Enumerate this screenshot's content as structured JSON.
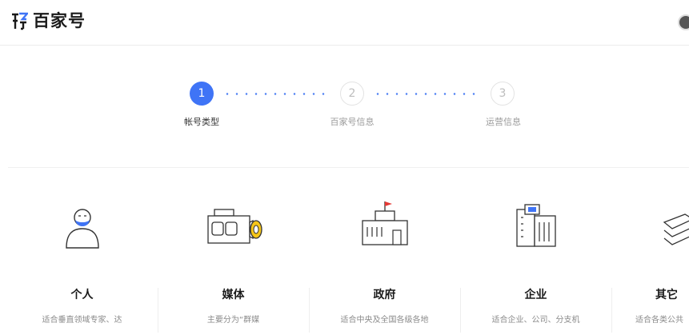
{
  "header": {
    "logo_text": "百家号"
  },
  "steps": [
    {
      "number": "1",
      "label": "帐号类型",
      "active": true
    },
    {
      "number": "2",
      "label": "百家号信息",
      "active": false
    },
    {
      "number": "3",
      "label": "运营信息",
      "active": false
    }
  ],
  "account_types": [
    {
      "title": "个人",
      "description": "适合垂直领域专家、达",
      "icon": "person-icon"
    },
    {
      "title": "媒体",
      "description": "主要分为“群媒",
      "icon": "camera-icon"
    },
    {
      "title": "政府",
      "description": "适合中央及全国各级各地",
      "icon": "government-building-icon"
    },
    {
      "title": "企业",
      "description": "适合企业、公司、分支机",
      "icon": "office-building-icon"
    },
    {
      "title": "其它",
      "description": "适合各类公共",
      "icon": "other-stack-icon"
    }
  ],
  "colors": {
    "accent": "#3f74f6",
    "inactive": "#bdbdbd",
    "text_primary": "#1a1a1a",
    "text_secondary": "#8a8a8a"
  }
}
